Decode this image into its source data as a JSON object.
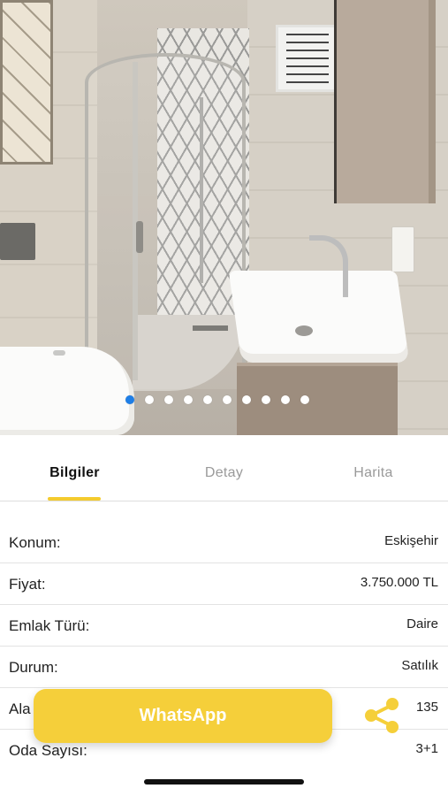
{
  "gallery": {
    "image_count": 10,
    "active_index": 0,
    "active_dot_color": "#1e7ee6"
  },
  "tabs": [
    {
      "label": "Bilgiler",
      "active": true
    },
    {
      "label": "Detay",
      "active": false
    },
    {
      "label": "Harita",
      "active": false
    }
  ],
  "details": [
    {
      "key": "Konum:",
      "value": "Eskişehir"
    },
    {
      "key": "Fiyat:",
      "value": "3.750.000 TL"
    },
    {
      "key": "Emlak Türü:",
      "value": "Daire"
    },
    {
      "key": "Durum:",
      "value": "Satılık"
    },
    {
      "key": "Ala",
      "value": "135"
    },
    {
      "key": "Oda Sayısı:",
      "value": "3+1"
    }
  ],
  "actions": {
    "whatsapp_label": "WhatsApp",
    "share_icon": "share-icon"
  },
  "colors": {
    "accent": "#f4cb2e",
    "whatsapp_button": "#f5cf3a"
  }
}
